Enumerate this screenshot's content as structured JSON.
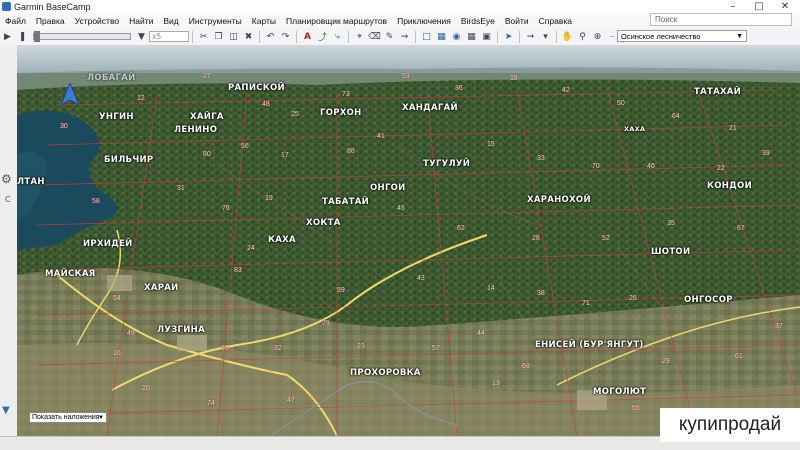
{
  "window": {
    "title": "Garmin BaseCamp",
    "min_icon": "minimize-icon",
    "max_icon": "maximize-icon",
    "close_icon": "close-icon"
  },
  "menu": [
    "Файл",
    "Правка",
    "Устройство",
    "Найти",
    "Вид",
    "Инструменты",
    "Карты",
    "Планировщик маршрутов",
    "Приключения",
    "BirdsEye",
    "Войти",
    "Справка"
  ],
  "search": {
    "placeholder": "Поиск"
  },
  "toolbar": {
    "zoom_value": "x5",
    "map_product": "Осинское лесничество"
  },
  "left": {
    "c_label": "С"
  },
  "overlay": {
    "label": "Показать наложения"
  },
  "map": {
    "towns": [
      "ЛОБАГАЙ",
      "РАПИСКОЙ",
      "УНГИН",
      "ХАЙГА",
      "ЛЕНИНО",
      "ГОРХОН",
      "ХАНДАГАЙ",
      "ТАТАХАЙ",
      "БИЛЬЧИР",
      "ТУГУЛУЙ",
      "ОНГОИ",
      "ЛТАН",
      "ТАБАТАЙ",
      "ХАРАНОХОЙ",
      "КОНДОИ",
      "ХОКТА",
      "ИРХИДЕЙ",
      "КАХА",
      "МАЙСКАЯ",
      "ШОТОИ",
      "ХАРАИ",
      "ОНГОСОР",
      "ЛУЗГИНА",
      "ЕНИСЕЙ (БУР'ЯНГУТ)",
      "ПРОХОРОВКА",
      "МОГОЛЮТ"
    ],
    "small_labels": [
      "ХАХА"
    ],
    "quarters": [
      "30",
      "27",
      "12",
      "48",
      "25",
      "73",
      "53",
      "36",
      "18",
      "42",
      "50",
      "64",
      "21",
      "39",
      "80",
      "56",
      "17",
      "88",
      "41",
      "15",
      "33",
      "70",
      "46",
      "22",
      "58",
      "31",
      "76",
      "19",
      "45",
      "62",
      "28",
      "52",
      "35",
      "67",
      "24",
      "83",
      "59",
      "43",
      "14",
      "38",
      "71",
      "26",
      "54",
      "49",
      "16",
      "65",
      "32",
      "79",
      "23",
      "57",
      "44",
      "68",
      "29",
      "61",
      "37",
      "20",
      "74",
      "47",
      "13",
      "55"
    ]
  },
  "watermark": "купипродай",
  "colors": {
    "route_red": "#d23a3a",
    "road_yellow": "#f2d96a",
    "lake": "#1b4a5c",
    "forest": "#3d5b32"
  }
}
